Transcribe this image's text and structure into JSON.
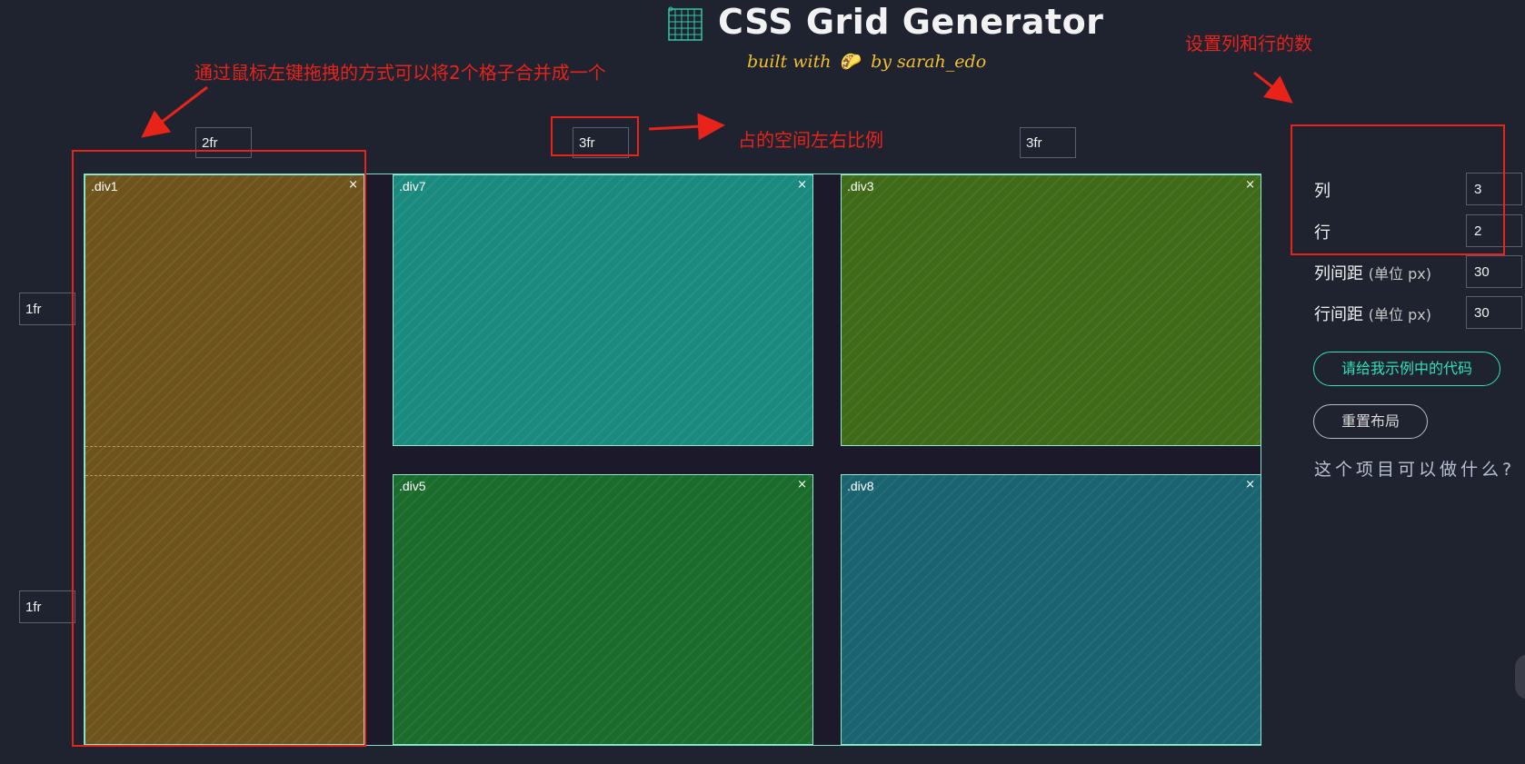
{
  "header": {
    "title": "CSS Grid Generator",
    "subtitle_pre": "built with",
    "subtitle_post": "by sarah_edo",
    "taco_icon": "taco-icon"
  },
  "columns": {
    "sizes": [
      "2fr",
      "3fr",
      "3fr"
    ]
  },
  "rows": {
    "sizes": [
      "1fr",
      "1fr"
    ]
  },
  "cells": [
    {
      "label": ".div1",
      "close": "×",
      "color": "#6e541c"
    },
    {
      "label": ".div7",
      "close": "×",
      "color": "#1a8a7e"
    },
    {
      "label": ".div3",
      "close": "×",
      "color": "#3f6a18"
    },
    {
      "label": ".div5",
      "close": "×",
      "color": "#1a6b2c"
    },
    {
      "label": ".div8",
      "close": "×",
      "color": "#1a6370"
    }
  ],
  "panel": {
    "columns_label": "列",
    "columns_value": "3",
    "rows_label": "行",
    "rows_value": "2",
    "col_gap_label": "列间距",
    "col_gap_unit": "(单位 px)",
    "col_gap_value": "30",
    "row_gap_label": "行间距",
    "row_gap_unit": "(单位 px)",
    "row_gap_value": "30",
    "code_button": "请给我示例中的代码",
    "reset_button": "重置布局",
    "what_link": "这个项目可以做什么?"
  },
  "annotations": {
    "merge": "通过鼠标左键拖拽的方式可以将2个格子合并成一个",
    "ratio": "占的空间左右比例",
    "setcount": "设置列和行的数",
    "color": "#e8231a"
  }
}
